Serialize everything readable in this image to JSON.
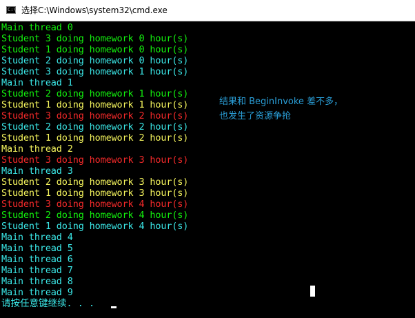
{
  "window": {
    "title": "选择C:\\Windows\\system32\\cmd.exe",
    "icon_text": "C:\\",
    "icon": "console-icon"
  },
  "colors": {
    "lime": "#13f30e",
    "cyan": "#3be8e8",
    "yellow": "#f7f75e",
    "red": "#f62a2a",
    "annotation": "#2a9fd8"
  },
  "console": {
    "lines": [
      {
        "text": "Main thread 0",
        "color": "lime"
      },
      {
        "text": "Student 3 doing homework 0 hour(s)",
        "color": "lime"
      },
      {
        "text": "Student 1 doing homework 0 hour(s)",
        "color": "lime"
      },
      {
        "text": "Student 2 doing homework 0 hour(s)",
        "color": "cyan"
      },
      {
        "text": "Student 3 doing homework 1 hour(s)",
        "color": "cyan"
      },
      {
        "text": "Main thread 1",
        "color": "cyan"
      },
      {
        "text": "Student 2 doing homework 1 hour(s)",
        "color": "lime"
      },
      {
        "text": "Student 1 doing homework 1 hour(s)",
        "color": "yellow"
      },
      {
        "text": "Student 3 doing homework 2 hour(s)",
        "color": "red"
      },
      {
        "text": "Student 2 doing homework 2 hour(s)",
        "color": "cyan"
      },
      {
        "text": "Student 1 doing homework 2 hour(s)",
        "color": "yellow"
      },
      {
        "text": "Main thread 2",
        "color": "yellow"
      },
      {
        "text": "Student 3 doing homework 3 hour(s)",
        "color": "red"
      },
      {
        "text": "Main thread 3",
        "color": "cyan"
      },
      {
        "text": "Student 2 doing homework 3 hour(s)",
        "color": "yellow"
      },
      {
        "text": "Student 1 doing homework 3 hour(s)",
        "color": "yellow"
      },
      {
        "text": "Student 3 doing homework 4 hour(s)",
        "color": "red"
      },
      {
        "text": "Student 2 doing homework 4 hour(s)",
        "color": "lime"
      },
      {
        "text": "Student 1 doing homework 4 hour(s)",
        "color": "cyan"
      },
      {
        "text": "Main thread 4",
        "color": "cyan"
      },
      {
        "text": "Main thread 5",
        "color": "cyan"
      },
      {
        "text": "Main thread 6",
        "color": "cyan"
      },
      {
        "text": "Main thread 7",
        "color": "cyan"
      },
      {
        "text": "Main thread 8",
        "color": "cyan"
      },
      {
        "text": "Main thread 9",
        "color": "cyan"
      }
    ],
    "prompt": "请按任意键继续. . .",
    "prompt_color": "cyan"
  },
  "annotation": {
    "line1": "结果和 BeginInvoke 差不多，",
    "line2": "也发生了资源争抢"
  }
}
